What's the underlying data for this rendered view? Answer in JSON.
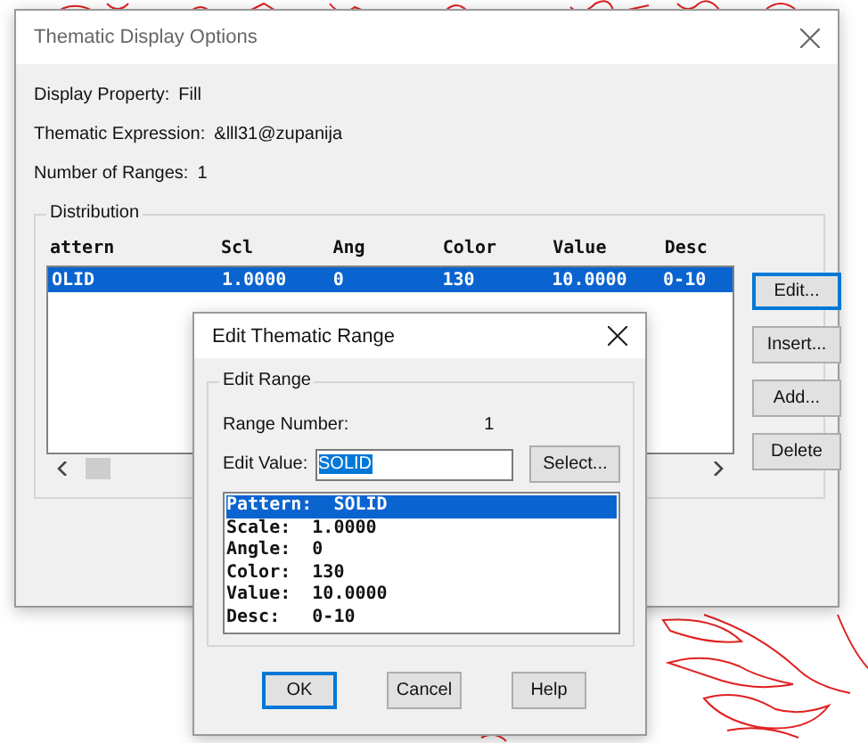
{
  "main_dialog": {
    "title": "Thematic Display Options",
    "info": [
      {
        "label": "Display Property:",
        "value": "Fill"
      },
      {
        "label": "Thematic  Expression:",
        "value": "&lll31@zupanija"
      },
      {
        "label": "Number of Ranges:",
        "value": "1"
      }
    ],
    "distribution": {
      "title": "Distribution",
      "columns": [
        "attern",
        "Scl",
        "Ang",
        "Color",
        "Value",
        "Desc"
      ],
      "rows": [
        {
          "cells": [
            "OLID",
            "1.0000",
            "0",
            "130",
            "10.0000",
            "0-10"
          ],
          "selected": true
        }
      ]
    },
    "buttons": [
      {
        "label": "Edit...",
        "default": true
      },
      {
        "label": "Insert...",
        "default": false
      },
      {
        "label": "Add...",
        "default": false
      },
      {
        "label": "Delete",
        "default": false
      }
    ]
  },
  "edit_dialog": {
    "title": "Edit Thematic Range",
    "group": "Edit Range",
    "range_number": {
      "label": "Range Number:",
      "value": "1"
    },
    "edit_value": {
      "label": "Edit Value:",
      "value": "SOLID",
      "text_selected": true
    },
    "select_button": "Select...",
    "properties": [
      {
        "text": "Pattern:  SOLID",
        "selected": true
      },
      {
        "text": "Scale:  1.0000",
        "selected": false
      },
      {
        "text": "Angle:  0",
        "selected": false
      },
      {
        "text": "Color:  130",
        "selected": false
      },
      {
        "text": "Value:  10.0000",
        "selected": false
      },
      {
        "text": "Desc:   0-10",
        "selected": false
      }
    ],
    "buttons": [
      {
        "label": "OK",
        "default": true
      },
      {
        "label": "Cancel",
        "default": false
      },
      {
        "label": "Help",
        "default": false
      }
    ]
  }
}
